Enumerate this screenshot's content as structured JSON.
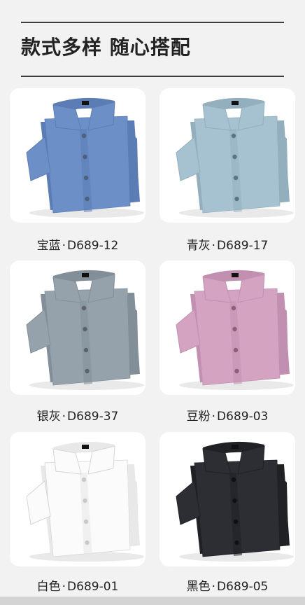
{
  "heading": "款式多样  随心搭配",
  "products": [
    {
      "color_name": "宝蓝",
      "code": "D689-12",
      "shirt_color": "#6d8fc7",
      "shade_color": "#5b7db4",
      "button_color": "#4d5f7a"
    },
    {
      "color_name": "青灰",
      "code": "D689-17",
      "shirt_color": "#a6c1cf",
      "shade_color": "#93aebd",
      "button_color": "#5f7480"
    },
    {
      "color_name": "银灰",
      "code": "D689-37",
      "shirt_color": "#95a2ab",
      "shade_color": "#828f98",
      "button_color": "#5a636b"
    },
    {
      "color_name": "豆粉",
      "code": "D689-03",
      "shirt_color": "#d4a3c2",
      "shade_color": "#c18fb0",
      "button_color": "#8a6079"
    },
    {
      "color_name": "白色",
      "code": "D689-01",
      "shirt_color": "#fbfbfb",
      "shade_color": "#e8e8e8",
      "button_color": "#c9c9c9"
    },
    {
      "color_name": "黑色",
      "code": "D689-05",
      "shirt_color": "#2c2e33",
      "shade_color": "#1f2125",
      "button_color": "#0f1012"
    }
  ],
  "separator": "·"
}
